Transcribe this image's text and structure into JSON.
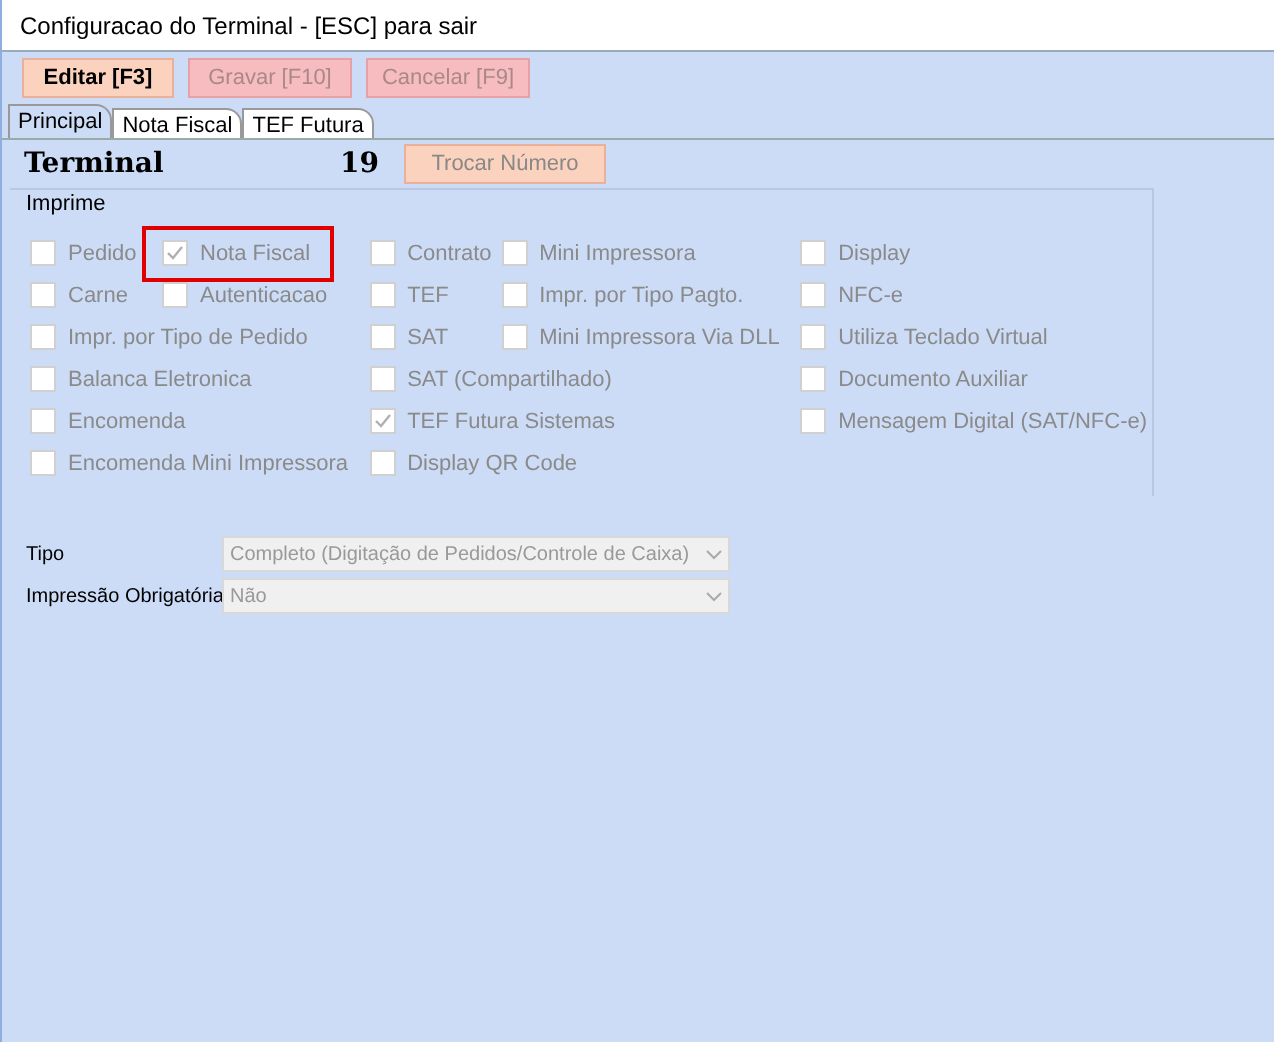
{
  "window": {
    "title": "Configuracao do Terminal - [ESC] para sair"
  },
  "toolbar": [
    {
      "label": "Editar [F3]",
      "disabled": false
    },
    {
      "label": "Gravar [F10]",
      "disabled": true
    },
    {
      "label": "Cancelar [F9]",
      "disabled": true
    }
  ],
  "tabs": [
    {
      "label": "Principal",
      "selected": true
    },
    {
      "label": "Nota Fiscal",
      "selected": false
    },
    {
      "label": "TEF Futura",
      "selected": false
    }
  ],
  "terminal": {
    "label": "Terminal",
    "number": "19",
    "button": "Trocar Número"
  },
  "imprime": {
    "title": "Imprime",
    "columns": [
      [
        {
          "label": "Pedido",
          "checked": false,
          "highlighted": false
        },
        {
          "label": "Carne",
          "checked": false,
          "highlighted": false
        },
        {
          "label": "Impr. por Tipo de Pedido",
          "checked": false,
          "highlighted": false
        },
        {
          "label": "Balanca Eletronica",
          "checked": false,
          "highlighted": false
        },
        {
          "label": "Encomenda",
          "checked": false,
          "highlighted": false
        },
        {
          "label": "Encomenda Mini Impressora",
          "checked": false,
          "highlighted": false
        }
      ],
      [
        {
          "label": "Nota Fiscal",
          "checked": true,
          "highlighted": true
        },
        {
          "label": "Autenticacao",
          "checked": false,
          "highlighted": false
        }
      ],
      [
        {
          "label": "Contrato",
          "checked": false,
          "highlighted": false
        },
        {
          "label": "TEF",
          "checked": false,
          "highlighted": false
        },
        {
          "label": "SAT",
          "checked": false,
          "highlighted": false
        },
        {
          "label": "SAT (Compartilhado)",
          "checked": false,
          "highlighted": false
        },
        {
          "label": "TEF Futura Sistemas",
          "checked": true,
          "highlighted": false
        },
        {
          "label": "Display QR Code",
          "checked": false,
          "highlighted": false
        }
      ],
      [
        {
          "label": "Mini Impressora",
          "checked": false,
          "highlighted": false
        },
        {
          "label": "Impr. por Tipo Pagto.",
          "checked": false,
          "highlighted": false
        },
        {
          "label": "Mini Impressora Via DLL",
          "checked": false,
          "highlighted": false
        }
      ],
      [
        {
          "label": "Display",
          "checked": false,
          "highlighted": false
        },
        {
          "label": "NFC-e",
          "checked": false,
          "highlighted": false
        },
        {
          "label": "Utiliza Teclado Virtual",
          "checked": false,
          "highlighted": false
        },
        {
          "label": "Documento Auxiliar",
          "checked": false,
          "highlighted": false
        },
        {
          "label": "Mensagem Digital (SAT/NFC-e)",
          "checked": false,
          "highlighted": false
        }
      ]
    ]
  },
  "fields": [
    {
      "label": "Tipo",
      "value": "Completo (Digitação de Pedidos/Controle de Caixa)"
    },
    {
      "label": "Impressão Obrigatória",
      "value": "Não"
    }
  ]
}
